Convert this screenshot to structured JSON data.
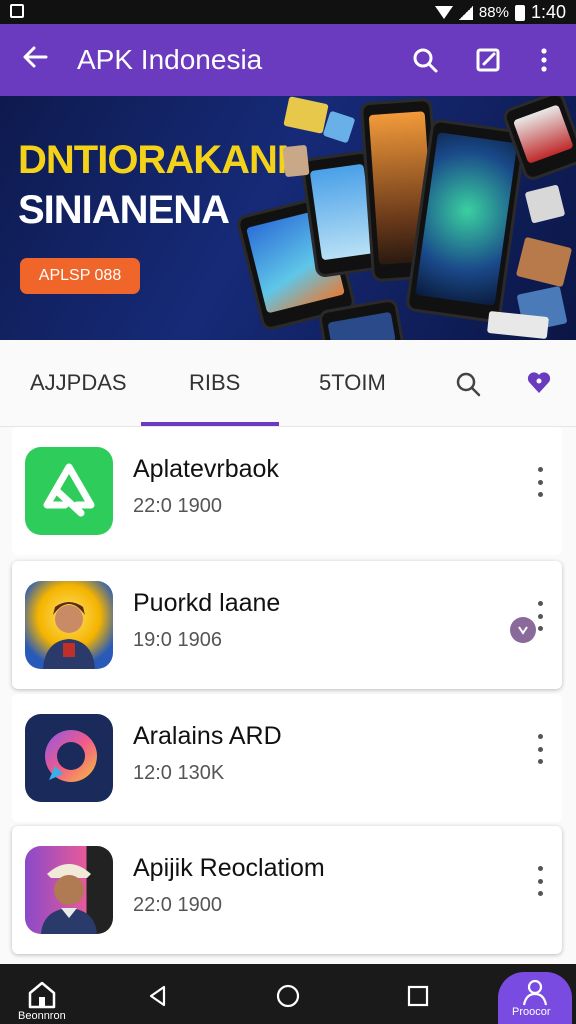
{
  "statusbar": {
    "battery": "88%",
    "time": "1:40"
  },
  "appbar": {
    "title": "APK Indonesia"
  },
  "banner": {
    "headline1": "DNTIORAKANN",
    "headline2": "SINIANENA",
    "cta": "APLSP 088"
  },
  "tabs": [
    {
      "label": "AJJPDAS"
    },
    {
      "label": "RIBS"
    },
    {
      "label": "5TOIM"
    }
  ],
  "apps": [
    {
      "name": "Aplatevrbaok",
      "meta": "22:0 1900",
      "icon": "recycle-icon"
    },
    {
      "name": "Puorkd laane",
      "meta": "19:0 1906",
      "icon": "portrait-icon"
    },
    {
      "name": "Aralains ARD",
      "meta": "12:0 130K",
      "icon": "chat-ring-icon"
    },
    {
      "name": "Apijik Reoclatiom",
      "meta": "22:0 1900",
      "icon": "man-hat-icon"
    }
  ],
  "bottom_nav": {
    "home_label": "Beonnron",
    "profile_label": "Proocor"
  },
  "colors": {
    "primary": "#6a3bbf",
    "accent": "#f0662a",
    "banner_bg": "#162a78",
    "green": "#2ecc5a"
  }
}
